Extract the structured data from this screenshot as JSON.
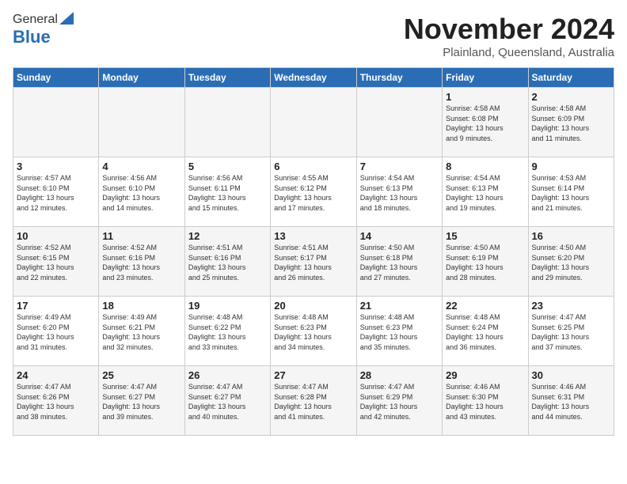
{
  "logo": {
    "general": "General",
    "blue": "Blue"
  },
  "header": {
    "month": "November 2024",
    "location": "Plainland, Queensland, Australia"
  },
  "days_header": [
    "Sunday",
    "Monday",
    "Tuesday",
    "Wednesday",
    "Thursday",
    "Friday",
    "Saturday"
  ],
  "weeks": [
    [
      {
        "day": "",
        "info": ""
      },
      {
        "day": "",
        "info": ""
      },
      {
        "day": "",
        "info": ""
      },
      {
        "day": "",
        "info": ""
      },
      {
        "day": "",
        "info": ""
      },
      {
        "day": "1",
        "info": "Sunrise: 4:58 AM\nSunset: 6:08 PM\nDaylight: 13 hours\nand 9 minutes."
      },
      {
        "day": "2",
        "info": "Sunrise: 4:58 AM\nSunset: 6:09 PM\nDaylight: 13 hours\nand 11 minutes."
      }
    ],
    [
      {
        "day": "3",
        "info": "Sunrise: 4:57 AM\nSunset: 6:10 PM\nDaylight: 13 hours\nand 12 minutes."
      },
      {
        "day": "4",
        "info": "Sunrise: 4:56 AM\nSunset: 6:10 PM\nDaylight: 13 hours\nand 14 minutes."
      },
      {
        "day": "5",
        "info": "Sunrise: 4:56 AM\nSunset: 6:11 PM\nDaylight: 13 hours\nand 15 minutes."
      },
      {
        "day": "6",
        "info": "Sunrise: 4:55 AM\nSunset: 6:12 PM\nDaylight: 13 hours\nand 17 minutes."
      },
      {
        "day": "7",
        "info": "Sunrise: 4:54 AM\nSunset: 6:13 PM\nDaylight: 13 hours\nand 18 minutes."
      },
      {
        "day": "8",
        "info": "Sunrise: 4:54 AM\nSunset: 6:13 PM\nDaylight: 13 hours\nand 19 minutes."
      },
      {
        "day": "9",
        "info": "Sunrise: 4:53 AM\nSunset: 6:14 PM\nDaylight: 13 hours\nand 21 minutes."
      }
    ],
    [
      {
        "day": "10",
        "info": "Sunrise: 4:52 AM\nSunset: 6:15 PM\nDaylight: 13 hours\nand 22 minutes."
      },
      {
        "day": "11",
        "info": "Sunrise: 4:52 AM\nSunset: 6:16 PM\nDaylight: 13 hours\nand 23 minutes."
      },
      {
        "day": "12",
        "info": "Sunrise: 4:51 AM\nSunset: 6:16 PM\nDaylight: 13 hours\nand 25 minutes."
      },
      {
        "day": "13",
        "info": "Sunrise: 4:51 AM\nSunset: 6:17 PM\nDaylight: 13 hours\nand 26 minutes."
      },
      {
        "day": "14",
        "info": "Sunrise: 4:50 AM\nSunset: 6:18 PM\nDaylight: 13 hours\nand 27 minutes."
      },
      {
        "day": "15",
        "info": "Sunrise: 4:50 AM\nSunset: 6:19 PM\nDaylight: 13 hours\nand 28 minutes."
      },
      {
        "day": "16",
        "info": "Sunrise: 4:50 AM\nSunset: 6:20 PM\nDaylight: 13 hours\nand 29 minutes."
      }
    ],
    [
      {
        "day": "17",
        "info": "Sunrise: 4:49 AM\nSunset: 6:20 PM\nDaylight: 13 hours\nand 31 minutes."
      },
      {
        "day": "18",
        "info": "Sunrise: 4:49 AM\nSunset: 6:21 PM\nDaylight: 13 hours\nand 32 minutes."
      },
      {
        "day": "19",
        "info": "Sunrise: 4:48 AM\nSunset: 6:22 PM\nDaylight: 13 hours\nand 33 minutes."
      },
      {
        "day": "20",
        "info": "Sunrise: 4:48 AM\nSunset: 6:23 PM\nDaylight: 13 hours\nand 34 minutes."
      },
      {
        "day": "21",
        "info": "Sunrise: 4:48 AM\nSunset: 6:23 PM\nDaylight: 13 hours\nand 35 minutes."
      },
      {
        "day": "22",
        "info": "Sunrise: 4:48 AM\nSunset: 6:24 PM\nDaylight: 13 hours\nand 36 minutes."
      },
      {
        "day": "23",
        "info": "Sunrise: 4:47 AM\nSunset: 6:25 PM\nDaylight: 13 hours\nand 37 minutes."
      }
    ],
    [
      {
        "day": "24",
        "info": "Sunrise: 4:47 AM\nSunset: 6:26 PM\nDaylight: 13 hours\nand 38 minutes."
      },
      {
        "day": "25",
        "info": "Sunrise: 4:47 AM\nSunset: 6:27 PM\nDaylight: 13 hours\nand 39 minutes."
      },
      {
        "day": "26",
        "info": "Sunrise: 4:47 AM\nSunset: 6:27 PM\nDaylight: 13 hours\nand 40 minutes."
      },
      {
        "day": "27",
        "info": "Sunrise: 4:47 AM\nSunset: 6:28 PM\nDaylight: 13 hours\nand 41 minutes."
      },
      {
        "day": "28",
        "info": "Sunrise: 4:47 AM\nSunset: 6:29 PM\nDaylight: 13 hours\nand 42 minutes."
      },
      {
        "day": "29",
        "info": "Sunrise: 4:46 AM\nSunset: 6:30 PM\nDaylight: 13 hours\nand 43 minutes."
      },
      {
        "day": "30",
        "info": "Sunrise: 4:46 AM\nSunset: 6:31 PM\nDaylight: 13 hours\nand 44 minutes."
      }
    ]
  ]
}
